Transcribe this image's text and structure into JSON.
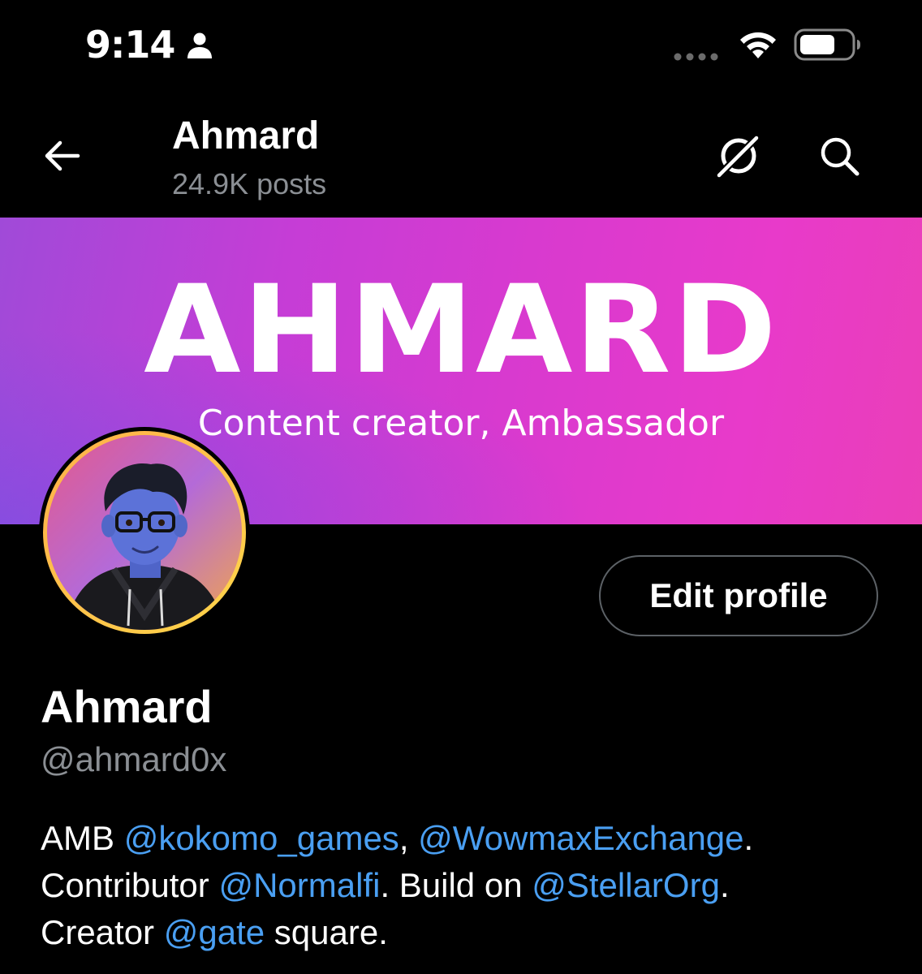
{
  "status_bar": {
    "time": "9:14"
  },
  "header": {
    "title": "Ahmard",
    "subtitle": "24.9K posts"
  },
  "banner": {
    "title": "AHMARD",
    "subtitle": "Content creator, Ambassador"
  },
  "profile": {
    "edit_button_label": "Edit profile",
    "display_name": "Ahmard",
    "handle": "@ahmard0x",
    "bio": {
      "line1": {
        "t1": "AMB ",
        "m1": "@kokomo_games",
        "t2": ", ",
        "m2": "@WowmaxExchange",
        "t3": "."
      },
      "line2": {
        "t1": "Contributor ",
        "m1": "@Normalfi",
        "t2": ". Build on ",
        "m2": "@StellarOrg",
        "t3": "."
      },
      "line3": {
        "t1": "Creator ",
        "m1": "@gate",
        "t2": " square."
      }
    }
  },
  "icons": {
    "status_person": "person-icon",
    "status_signal": "signal-dots-icon",
    "status_wifi": "wifi-icon",
    "status_battery": "battery-icon",
    "back": "back-arrow-icon",
    "grok": "grok-icon",
    "search": "search-icon"
  },
  "colors": {
    "background": "#000000",
    "secondary_text": "#8b8f94",
    "link": "#4a9ff2",
    "banner_gradient_start": "#a04ad8",
    "banner_gradient_end": "#ea3fb8"
  }
}
